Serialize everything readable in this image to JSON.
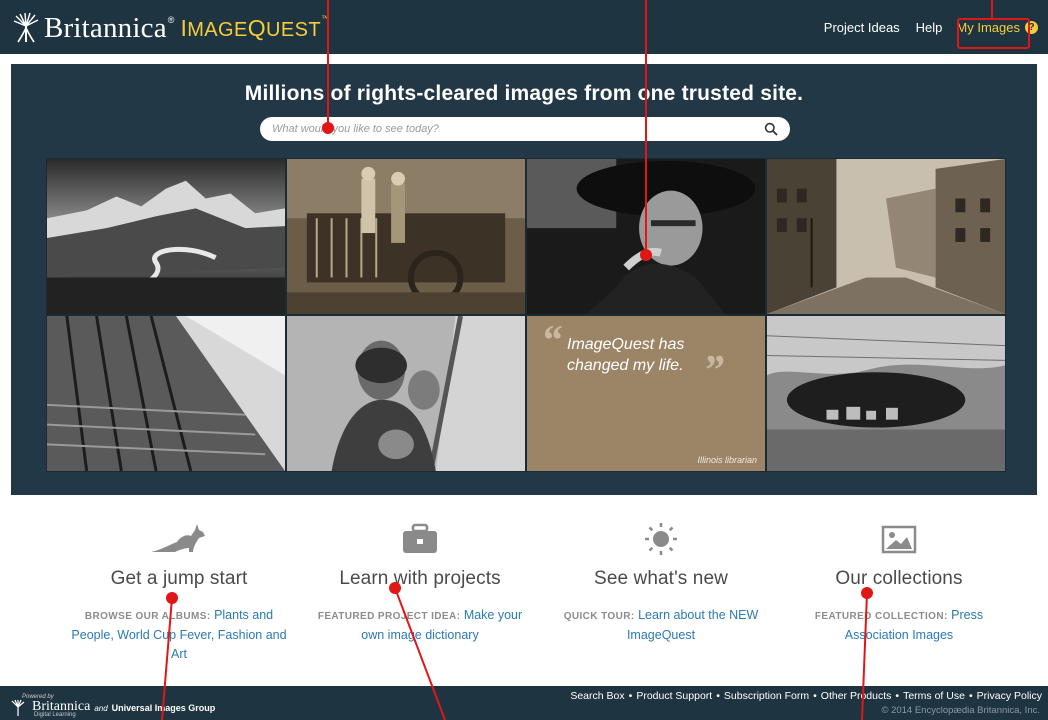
{
  "header": {
    "brand": "Britannica",
    "registered": "®",
    "product_prefix": "I",
    "product_small": "MAGE",
    "product_q": "Q",
    "product_rest": "UEST",
    "trademark": "™",
    "nav": {
      "project_ideas": "Project Ideas",
      "help": "Help",
      "my_images": "My Images",
      "help_glyph": "?"
    }
  },
  "hero": {
    "title": "Millions of rights-cleared images from one trusted site.",
    "search_placeholder": "What would you like to see today?",
    "quote": {
      "open_mark": "“",
      "close_mark": "”",
      "text": "ImageQuest has changed my life.",
      "author": "Illinois librarian"
    }
  },
  "features": [
    {
      "icon": "kangaroo-icon",
      "heading": "Get a jump start",
      "label": "BROWSE OUR ALBUMS:",
      "link": "Plants and People, World Cup Fever, Fashion and Art"
    },
    {
      "icon": "briefcase-icon",
      "heading": "Learn with projects",
      "label": "FEATURED PROJECT IDEA:",
      "link": "Make your own image dictionary"
    },
    {
      "icon": "sun-icon",
      "heading": "See what's new",
      "label": "QUICK TOUR:",
      "link": "Learn about the NEW ImageQuest"
    },
    {
      "icon": "picture-icon",
      "heading": "Our collections",
      "label": "FEATURED COLLECTION:",
      "link": "Press Association Images"
    }
  ],
  "footer": {
    "powered_by": "Powered by",
    "logo": "Britannica",
    "digital_learning": "Digital Learning",
    "and": "and",
    "partner": "Universal Images Group",
    "links": [
      "Search Box",
      "Product Support",
      "Subscription Form",
      "Other Products",
      "Terms of Use",
      "Privacy Policy"
    ],
    "copyright": "© 2014 Encyclopædia Britannica, Inc."
  },
  "colors": {
    "header_bg": "#1f3441",
    "hero_bg": "#233846",
    "accent_yellow": "#f5cd3b",
    "link_blue": "#2a7ab5",
    "annotation_red": "#e01717"
  }
}
